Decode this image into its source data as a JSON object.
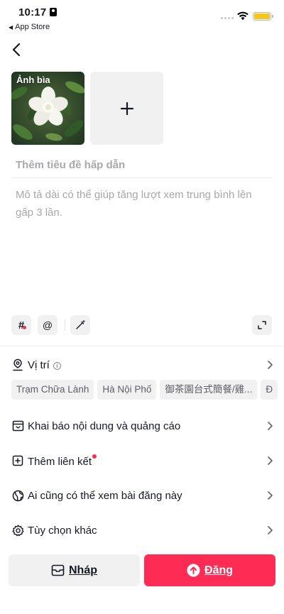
{
  "status_bar": {
    "time": "10:17",
    "back_app": "App Store",
    "battery_color": "#f5c518"
  },
  "header": {
    "back_icon": "chevron-left-icon"
  },
  "media": {
    "cover_label": "Ảnh bìa",
    "add_icon": "plus-icon"
  },
  "post": {
    "title_placeholder": "Thêm tiêu đề hấp dẫn",
    "title_value": "",
    "description_placeholder": "Mô tả dài có thể giúp tăng lượt xem trung bình lên gấp 3 lần.",
    "description_value": ""
  },
  "tools": {
    "hashtag_label": "#",
    "mention_label": "@",
    "magic_icon": "magic-wand-icon",
    "expand_icon": "expand-icon"
  },
  "location": {
    "label": "Vị trí",
    "info_glyph": "i",
    "chips": [
      "Trạm Chữa Lành",
      "Hà Nội Phố",
      "御茶園台式簡餐/雞...",
      "Đ"
    ]
  },
  "settings": {
    "disclosure_label": "Khai báo nội dung và quảng cáo",
    "add_link_label": "Thêm liên kết",
    "privacy_label": "Ai cũng có thể xem bài đăng này",
    "more_options_label": "Tùy chọn khác"
  },
  "actions": {
    "draft_label": "Nháp",
    "post_label": "Đăng",
    "post_color": "#fe2c55"
  }
}
